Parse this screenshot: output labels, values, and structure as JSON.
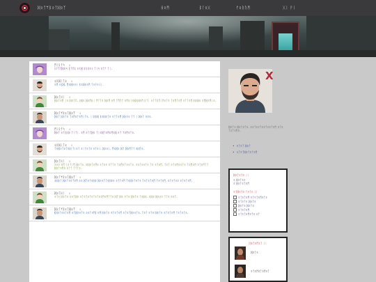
{
  "header": {
    "site_title": "ᛞᛟᛏᛘᛒᛟᛏᛞᛟᛉ",
    "nav": [
      {
        "label": "ᚺᛟᛗ"
      },
      {
        "label": "ᛒᛚᛟᚷ"
      },
      {
        "label": "ᚠᛟᚱᚢᛗ"
      },
      {
        "label": "ᚷᛁ ᚹᛁ"
      }
    ]
  },
  "feed": {
    "posts": [
      {
        "author": "ᛗᛁᚱᚨᛋ",
        "meta": "ᛟ",
        "text": "ᚱᚨᛏᛖᛞᛟᛋ ᛒᛏᛖᚱ ᛟᚾᛞ ᛒᚱᚺᛟᚾ ᛏᛁᛋ ᛟᛏᚨ ᛏᛁ.",
        "avatar": "purple-haired-character",
        "color": "purple"
      },
      {
        "author": "ᛟᛒᛞᛁᛏᛟ",
        "meta": "ᛟ",
        "text": "ᛟᛗ ᛟᛒᛞ. ᛗᛟᛞᛟᛟᚾ ᛒᛟᛞᛟᛟᛗ ᛏᛟᚹᛟᚾᛁ.",
        "avatar": "bearded-man",
        "color": "blue"
      },
      {
        "author": "ᛞᛟᛏᚺᛁ",
        "meta": "ᛟ",
        "text": "ᛞᛟᛏᛟᛗ ᛁᛟ ᛞᛟᛏᛖ. ᛟᛞᛟ ᛞᛟᛗᚺᛁ ᛗᛏᛏᛟ ᛞᛟᛗ ᛟᛗ ᛏᛗᛖᛏ ᛟᛗᚺᛁᛟᛞᛟᛞᛟᛗ ᚱᛏᛁ ᛟᛏᛏᛒᛖᛁᛗᛟᛏᛟ ᛏᛟᛗᛏᛟᛗ ᛟᛏᛏᛟᛗ ᛞᛟᛞᛟ ᛟᛗᛞᛟᛗᛁᛟ.",
        "avatar": "green-dressed-woman",
        "color": "olive"
      },
      {
        "author": "ᛞᛟᛏᛘᛒᛟᛏᛞᛟᛉ",
        "meta": "ᛟ",
        "text": "ᛞᛟᛏ ᛞᛟᛏᛟ ᛏᛟᛗᛟᛏᛟᛗᛁᛏᛟ. ᛁ ᛞᛟᛞ ᛒᛟᛞᛟᛏᛟ ᛟᛏᛏᛟᛗ ᛞᛟᛟᛟ ᛏᛏ ᛁ ᛞᛟᛏ ᛟᛟᛟ.",
        "avatar": "dark-haired-man",
        "color": "blue"
      },
      {
        "author": "ᛗᛁᚱᚨᛋ",
        "meta": "ᛟ",
        "text": "ᛞᛟᛏ ᛟᛏᚱᛞᛟ ᛏᛁᛏᛁ. ᛟᛗ ᛟᛏᛏᛞᛟ ᛏᛁᛟᛞᛏᛟᛗᛟᛗᛟᛞ ᛟᛏ ᛏᛟᛗᛟᛏᛟ.",
        "avatar": "purple-haired-character",
        "color": "purple"
      },
      {
        "author": "ᛟᛒᛞᛁᛏᛟ",
        "meta": "ᛟ",
        "text": "ᛏᛟᛞᛟᛏᛟᛏᛟᛞ ᛏᛁᛟᛏ ᛟᛁᛏᛟᛏᛟ ᛟᛏᛟᛁ. ᛞᛟᛟᛁ. ᛗᛟᛞᛟ ᛞᛏ ᛞᛟᛗᛏᛏ ᛟᛞᛏᛟ.",
        "avatar": "bearded-man",
        "color": "blue"
      },
      {
        "author": "ᛞᛟᛏᚺᛁ",
        "meta": "ᛟ",
        "text": "ᛟᛟᛟ ᛟᛗ ᛁᛟᛏᛁᛗ ᛞᛟᛏᛟ. ᛟᛞᛟᛏᛟᛗᛟ ᛟᛏᛟᛟ ᛟᛏᛏᛟ ᛏᛟᛗᛟᛏᛟᛟᛏᛟ. ᛟᛟᛏᛟᛟᛏᛟ ᛏᛟ ᛟᛏᛟᛗ. ᛏᛟᛏ ᛟᛏᛟᛗᛟᛟᛏᛟ ᛏᛟᛗᛟᛗ ᛟᛏᛟᛗᛏᛏ ᛞᛟᛏᛟᛗᛟ ᛟᛏᛏ ᛏᛏᛏᛟ.",
        "avatar": "green-dressed-woman",
        "color": "olive"
      },
      {
        "author": "ᛞᛟᛏᛘᛒᛟᛏᛞᛟᛉ",
        "meta": "ᛟ",
        "text": "ᛟᛞᛟᛏ ᛞᛟᛏᛟᛟᛏᛟᛗ ᛟᛟ ᛞᛏᛟᛏᛟᛞᛟ ᛞᛟᛟᛏᛏᛟᛞᛟᛟ ᛟᛏᛏᛟᛗ ᛏᛟᛞᛟᛏᛟᛏᛟ ᛏᛟᛏᛟᛏᛟᛗ ᛏᛟᛏᛟᛗ. ᛟᛏᛟᛏᛟᛟ ᛟᛏᛟᛏᛟᛗ.",
        "avatar": "dark-haired-man",
        "color": "blue"
      },
      {
        "author": "ᛞᛟᛏᚺᛁ",
        "meta": "ᛟ",
        "text": "ᛟᛏᛟ ᛞᛟᛏᛟ ᛟᛟᛏᛞᛟ ᛟᛏᛟᛏᛟᛏᛟᛏᛟᛏᛟᛟᛗᛟᛗᛏᛏᛟ ᛞᛏ ᛞᛟ ᛟᛏᛟ ᛞᛟᛏᛟ ᛏᛟᛞᛟ. ᛟᛞᛟ ᛞᛟᛟᛟ ᛏᛏᛟ ᛟᛟᛏ.",
        "avatar": "green-dressed-woman",
        "color": "olive"
      },
      {
        "author": "ᛞᛟᛏᛘᛒᛟᛏᛞᛟᛉ",
        "meta": "ᛟ",
        "text": "(ᛞᛟᛏᛟᛟᛏᛟᛗ ᛟᛏᛞᛟᛟᛏᛟ ᛟᛟᛏᛟᛗ) ᛟᛗ ᛞᛟᛏᛟ ᛟᛏᛟᛏᛟᛗ ᛟᛏᛟᛏᛞᛟᛟᛏᛟ. ᛏᛟᛏ ᛟᛏᛟ ᛞᛟᛏᛟ ᛟᛏᛟᛏᛟᛗ ᛏᛟᛏᛟᛏᛟ.",
        "avatar": "dark-haired-man",
        "color": "blue"
      }
    ]
  },
  "sidebar": {
    "x_mark": "X",
    "description": "ᛞᛟᛏᛟ ᛞᛟᛏᛟᛏᛟ. ᛟᛟᛏᛟᛟᛏᛟᛟᛏᛟᛟᛏᛟᛗ ᛟᛏᛟ ᛏᛟᛏᛟᛗᛟ.",
    "links": [
      {
        "label": "ᛟᛏᛟᛏ ᛞᛟᛏ"
      },
      {
        "label": "ᛟᛏᛟᛏᛞᛟᛏᛟᛏᛟᛗ"
      }
    ],
    "box1": {
      "heading": "ᛞᛟᛏᛟᛏᛟ ᛁᛁ",
      "rows_a": [
        "ᛟ ᛞᛟᛏᛟᛟ",
        "ᛟ ᛞᛟᛏᛟᛏᛟᛗ"
      ],
      "heading2": "ᛟᛏᛞᛟᛏᛟ ᛏᛟᛏᛟ ᛁᛁ",
      "rows_b": [
        "ᛟᛏᛟᛏᛟᛗ ᛟᛏᛟᛏᛟᛗᛟᛏᛟ",
        "ᛟᛏᛟᛏᛟ ᛞᛟᛏᛟ",
        "ᛞᛟᛏᛟ ᛞᛟᛏᛟ",
        "ᛟᛏᛟᛏᛟᛗ",
        "ᛟᛏᛟᛏᛟᛗᛟᛏᛟ ᛟᛏ"
      ]
    },
    "box2": {
      "heading": "ᛞᛟᛏᛟᛗᛟᛏ ᛁᛁ",
      "item1": "ᛞᛟᛏᛟ",
      "item2": "ᛟᛏᛟᛗᛟᛏᛟᛗᛟᛏ"
    }
  },
  "colors": {
    "topbar": "#3a3a3c",
    "accent_red": "#b3283a",
    "page_bg": "#c9c9c9",
    "post_purple": "#5a1d6e",
    "post_blue": "#274e8c",
    "post_olive": "#5f7f1c"
  }
}
